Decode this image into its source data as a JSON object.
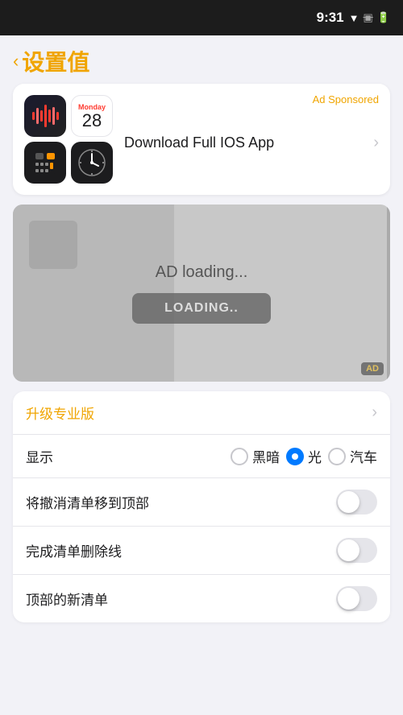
{
  "statusBar": {
    "time": "9:31"
  },
  "header": {
    "backLabel": "< 设置值"
  },
  "adCard": {
    "sponsoredLabel": "Ad Sponsored",
    "downloadLabel": "Download Full IOS App",
    "calendarDay": "Monday",
    "calendarDate": "28"
  },
  "adLoadingArea": {
    "loadingText": "AD loading...",
    "loadingBtnLabel": "LOADING..",
    "adBadge": "AD"
  },
  "settings": {
    "upgradeLabel": "升级专业版",
    "displayLabel": "显示",
    "displayOptions": [
      {
        "value": "dark",
        "label": "黑暗",
        "selected": false
      },
      {
        "value": "light",
        "label": "光",
        "selected": true
      },
      {
        "value": "auto",
        "label": "汽车",
        "selected": false
      }
    ],
    "row3Label": "将撤消清单移到顶部",
    "row4Label": "完成清单删除线",
    "row5Label": "顶部的新清单"
  }
}
